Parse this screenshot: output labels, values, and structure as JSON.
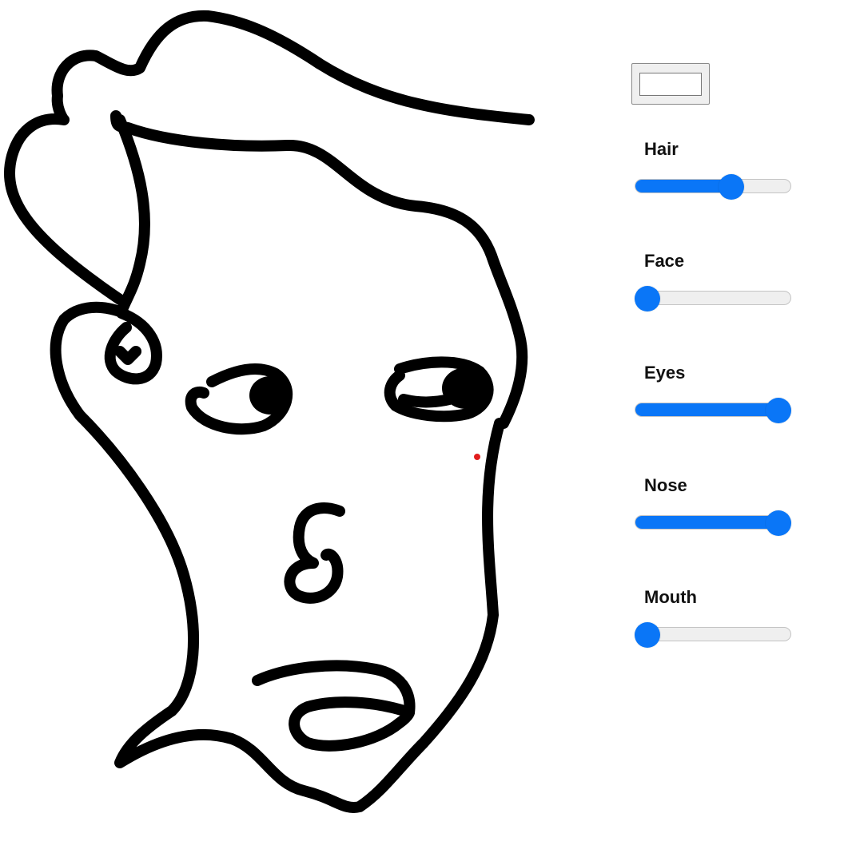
{
  "controls": {
    "color_swatch": {
      "value": "#ffffff"
    },
    "sliders": [
      {
        "key": "hair",
        "label": "Hair",
        "value": 0.64
      },
      {
        "key": "face",
        "label": "Face",
        "value": 0.0
      },
      {
        "key": "eyes",
        "label": "Eyes",
        "value": 1.0
      },
      {
        "key": "nose",
        "label": "Nose",
        "value": 1.0
      },
      {
        "key": "mouth",
        "label": "Mouth",
        "value": 0.0
      }
    ]
  },
  "colors": {
    "accent": "#0a76f7",
    "stroke": "#000000",
    "marker": "#e11d1d"
  }
}
